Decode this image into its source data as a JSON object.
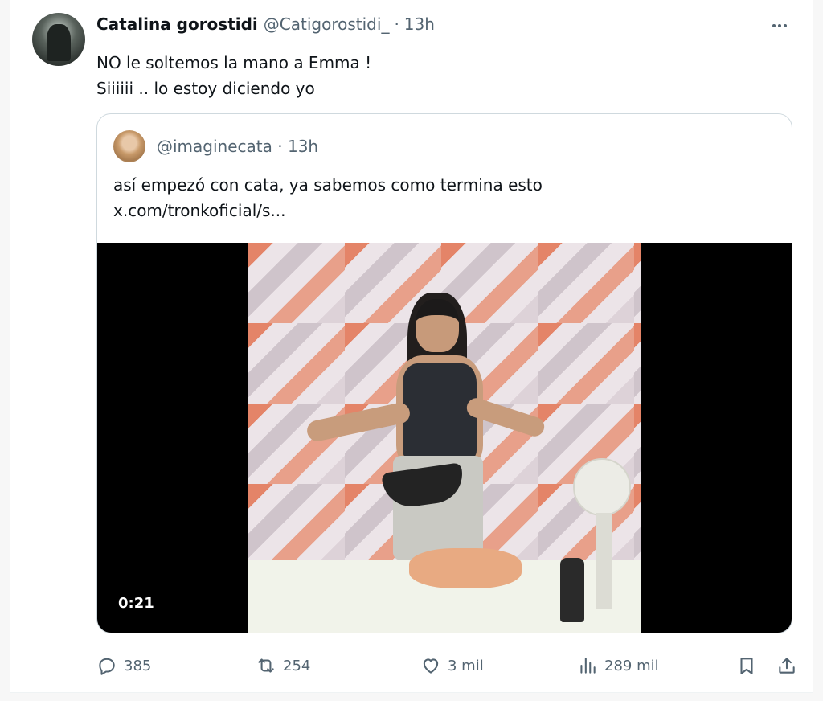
{
  "tweet": {
    "author_name": "Catalina gorostidi",
    "author_handle": "@Catigorostidi_",
    "separator": "·",
    "time": "13h",
    "lines": [
      "NO le soltemos la mano a Emma !",
      "Siiiiii .. lo estoy diciendo yo"
    ]
  },
  "quote": {
    "handle": "@imaginecata",
    "separator": "·",
    "time": "13h",
    "lines": [
      "así empezó con cata, ya sabemos como termina esto",
      "x.com/tronkoficial/s..."
    ],
    "video": {
      "duration": "0:21"
    }
  },
  "actions": {
    "replies": "385",
    "reposts": "254",
    "likes": "3 mil",
    "views": "289 mil"
  },
  "icons": {
    "more": "more-icon",
    "reply": "reply-icon",
    "repost": "repost-icon",
    "like": "heart-icon",
    "views": "views-icon",
    "bookmark": "bookmark-icon",
    "share": "share-icon"
  }
}
